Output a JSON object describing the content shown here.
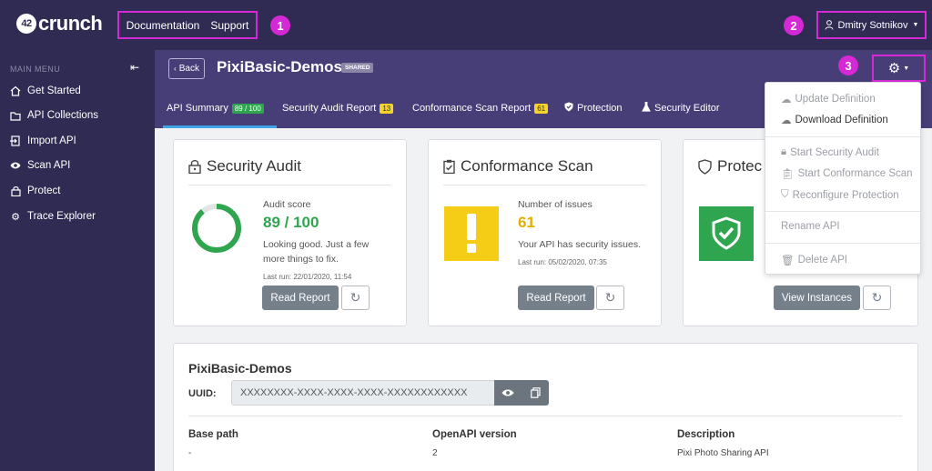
{
  "brand": {
    "name": "crunch",
    "badge": "42"
  },
  "top_links": [
    "Documentation",
    "Support"
  ],
  "callouts": [
    "1",
    "2",
    "3"
  ],
  "user": {
    "name": "Dmitry Sotnikov"
  },
  "sidebar": {
    "title": "MAIN MENU",
    "items": [
      {
        "label": "Get Started",
        "icon": "home-icon"
      },
      {
        "label": "API Collections",
        "icon": "folder-icon"
      },
      {
        "label": "Import API",
        "icon": "import-icon"
      },
      {
        "label": "Scan API",
        "icon": "eye-icon"
      },
      {
        "label": "Protect",
        "icon": "lock-icon"
      },
      {
        "label": "Trace Explorer",
        "icon": "gear-icon"
      }
    ]
  },
  "header": {
    "back_label": "Back",
    "title": "PixiBasic-Demos",
    "shared_badge": "SHARED"
  },
  "tabs": [
    {
      "label": "API Summary",
      "badge": "89 / 100"
    },
    {
      "label": "Security Audit Report",
      "badge": "13"
    },
    {
      "label": "Conformance Scan Report",
      "badge": "61"
    },
    {
      "label": "Protection"
    },
    {
      "label": "Security Editor"
    }
  ],
  "audit_card": {
    "title": "Security Audit",
    "metric_label": "Audit score",
    "value": "89 / 100",
    "text_line1": "Looking good. Just a few",
    "text_line2": "more things to fix.",
    "last_run": "Last run: 22/01/2020, 11:54",
    "button": "Read Report",
    "score_fraction": 0.89
  },
  "scan_card": {
    "title": "Conformance Scan",
    "metric_label": "Number of issues",
    "value": "61",
    "text": "Your API has security issues.",
    "last_run": "Last run: 05/02/2020, 07:35",
    "button": "Read Report"
  },
  "protect_card": {
    "title": "Protec",
    "button": "View Instances"
  },
  "dropdown": {
    "items": [
      {
        "label": "Update Definition",
        "enabled": false
      },
      {
        "label": "Download Definition",
        "enabled": true
      },
      {
        "label": "Start Security Audit",
        "enabled": false
      },
      {
        "label": "Start Conformance Scan",
        "enabled": false
      },
      {
        "label": "Reconfigure Protection",
        "enabled": false
      },
      {
        "label": "Rename API",
        "enabled": false
      },
      {
        "label": "Delete API",
        "enabled": false
      }
    ]
  },
  "details": {
    "title": "PixiBasic-Demos",
    "uuid_label": "UUID:",
    "uuid_value": "XXXXXXXX-XXXX-XXXX-XXXX-XXXXXXXXXXXX",
    "base_path_label": "Base path",
    "base_path_value": "-",
    "openapi_label": "OpenAPI version",
    "openapi_value": "2",
    "description_label": "Description",
    "description_value": "Pixi Photo Sharing API"
  },
  "colors": {
    "nav": "#302b52",
    "header": "#473d77",
    "accent": "#3fa4e3",
    "highlight": "#d629d6",
    "green": "#2fa550",
    "yellow": "#f6d22a"
  }
}
